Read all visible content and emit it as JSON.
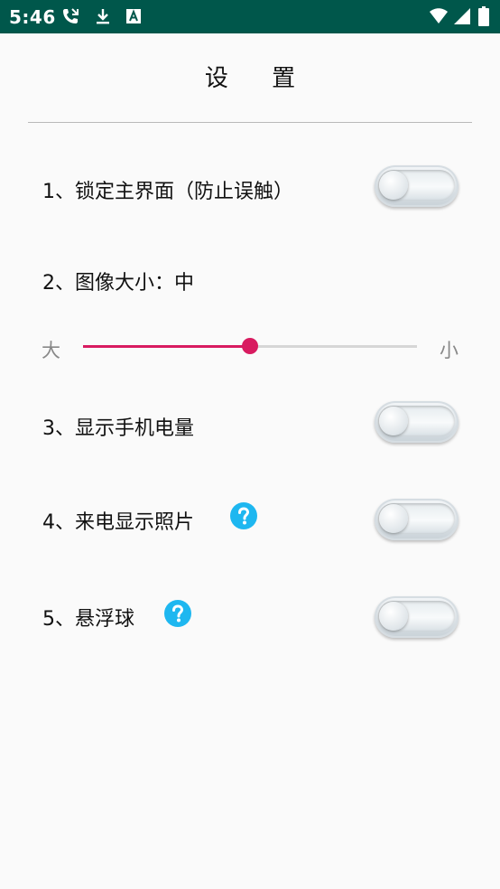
{
  "status_bar": {
    "time": "5:46",
    "left_icons": [
      "call-forwarded-icon",
      "download-icon",
      "a-badge-icon"
    ],
    "right_icons": [
      "wifi-icon",
      "signal-icon",
      "battery-icon"
    ],
    "background": "#00574b"
  },
  "page": {
    "title": "设 置"
  },
  "settings": {
    "lock_ui": {
      "label": "1、锁定主界面（防止误触）",
      "enabled": false
    },
    "image_size": {
      "label": "2、图像大小：中",
      "slider_min_label": "大",
      "slider_max_label": "小",
      "value_fraction": 0.5,
      "accent": "#d81b60"
    },
    "show_battery": {
      "label": "3、显示手机电量",
      "enabled": false
    },
    "caller_photo": {
      "label": "4、来电显示照片",
      "enabled": false,
      "help_icon": "help-icon"
    },
    "floating_ball": {
      "label": "5、悬浮球",
      "enabled": false,
      "help_icon": "help-icon"
    }
  },
  "colors": {
    "help_icon": "#1eb7f0",
    "accent": "#d81b60"
  }
}
